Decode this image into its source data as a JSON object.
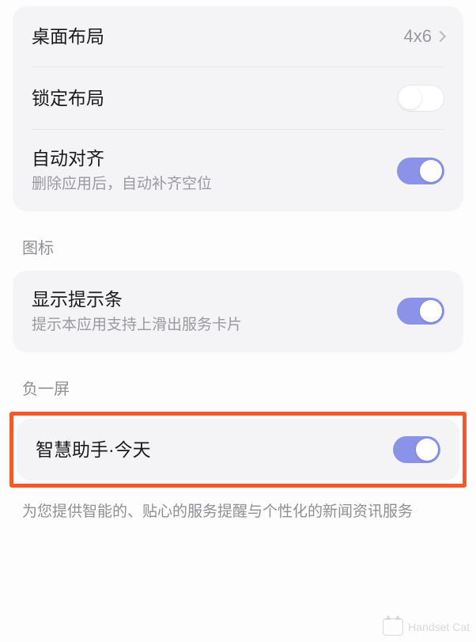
{
  "group_layout": {
    "desktop_layout": {
      "label": "桌面布局",
      "value": "4x6"
    },
    "lock_layout": {
      "label": "锁定布局",
      "toggle": false
    },
    "auto_align": {
      "label": "自动对齐",
      "desc": "删除应用后，自动补齐空位",
      "toggle": true
    }
  },
  "section_icons": {
    "header": "图标",
    "show_hint_bar": {
      "label": "显示提示条",
      "desc": "提示本应用支持上滑出服务卡片",
      "toggle": true
    }
  },
  "section_minus_one": {
    "header": "负一屏",
    "assistant_today": {
      "label": "智慧助手·今天",
      "toggle": true
    },
    "desc": "为您提供智能的、贴心的服务提醒与个性化的新闻资讯服务"
  },
  "watermark": "Handset Cat"
}
